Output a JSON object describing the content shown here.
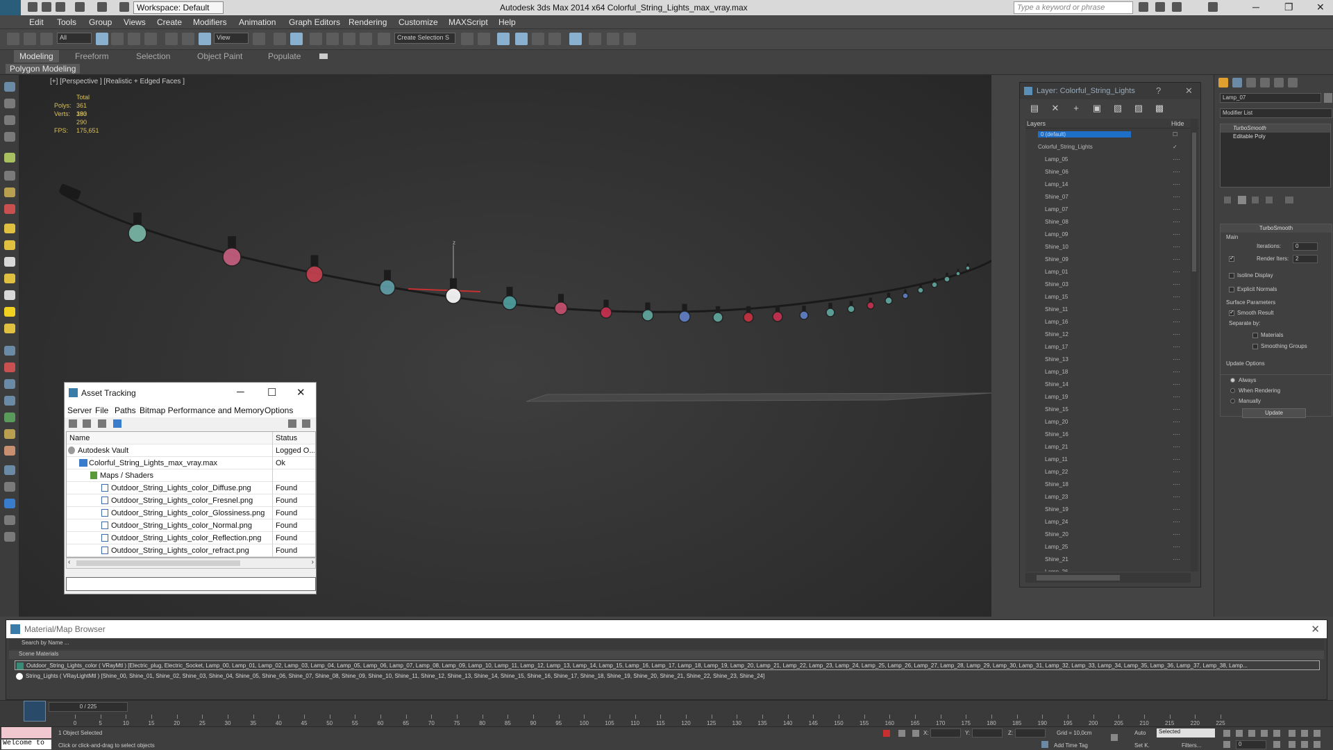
{
  "titlebar": {
    "workspace": "Workspace: Default",
    "title": "Autodesk 3ds Max  2014 x64      Colorful_String_Lights_max_vray.max",
    "search_placeholder": "Type a keyword or phrase"
  },
  "menu": [
    "Edit",
    "Tools",
    "Group",
    "Views",
    "Create",
    "Modifiers",
    "Animation",
    "Graph Editors",
    "Rendering",
    "Customize",
    "MAXScript",
    "Help"
  ],
  "toolbar": {
    "filter": "All",
    "refcoord": "View",
    "named_selection": "Create Selection S"
  },
  "ribbon": {
    "tabs": [
      "Modeling",
      "Freeform",
      "Selection",
      "Object Paint",
      "Populate"
    ],
    "panel_label": "Polygon Modeling"
  },
  "viewport": {
    "label": "[+] [Perspective ] [Realistic + Edged Faces ]",
    "stats_total": "Total",
    "polys_label": "Polys:",
    "polys_value": "361 390",
    "verts_label": "Verts:",
    "verts_value": "183 290",
    "fps_label": "FPS:",
    "fps_value": "175,651",
    "gizmo_label": "z"
  },
  "asset_tracking": {
    "title": "Asset Tracking",
    "menu": [
      "Server",
      "File",
      "Paths",
      "Bitmap Performance and Memory",
      "Options"
    ],
    "columns": [
      "Name",
      "Status"
    ],
    "rows": [
      {
        "name": "Autodesk Vault",
        "status": "Logged O..."
      },
      {
        "name": "Colorful_String_Lights_max_vray.max",
        "status": "Ok"
      },
      {
        "name": "Maps / Shaders",
        "status": ""
      },
      {
        "name": "Outdoor_String_Lights_color_Diffuse.png",
        "status": "Found"
      },
      {
        "name": "Outdoor_String_Lights_color_Fresnel.png",
        "status": "Found"
      },
      {
        "name": "Outdoor_String_Lights_color_Glossiness.png",
        "status": "Found"
      },
      {
        "name": "Outdoor_String_Lights_color_Normal.png",
        "status": "Found"
      },
      {
        "name": "Outdoor_String_Lights_color_Reflection.png",
        "status": "Found"
      },
      {
        "name": "Outdoor_String_Lights_color_refract.png",
        "status": "Found"
      }
    ]
  },
  "layer_explorer": {
    "title": "Layer: Colorful_String_Lights",
    "help": "?",
    "col_layers": "Layers",
    "col_hide": "Hide",
    "rows": [
      {
        "name": "0 (default)",
        "level": 1,
        "sel": true,
        "hide": "☐"
      },
      {
        "name": "Colorful_String_Lights",
        "level": 1,
        "hide": "✓"
      },
      {
        "name": "Lamp_05",
        "level": 2
      },
      {
        "name": "Shine_06",
        "level": 2
      },
      {
        "name": "Lamp_14",
        "level": 2
      },
      {
        "name": "Shine_07",
        "level": 2
      },
      {
        "name": "Lamp_07",
        "level": 2
      },
      {
        "name": "Shine_08",
        "level": 2
      },
      {
        "name": "Lamp_09",
        "level": 2
      },
      {
        "name": "Shine_10",
        "level": 2
      },
      {
        "name": "Shine_09",
        "level": 2
      },
      {
        "name": "Lamp_01",
        "level": 2
      },
      {
        "name": "Shine_03",
        "level": 2
      },
      {
        "name": "Lamp_15",
        "level": 2
      },
      {
        "name": "Shine_11",
        "level": 2
      },
      {
        "name": "Lamp_16",
        "level": 2
      },
      {
        "name": "Shine_12",
        "level": 2
      },
      {
        "name": "Lamp_17",
        "level": 2
      },
      {
        "name": "Shine_13",
        "level": 2
      },
      {
        "name": "Lamp_18",
        "level": 2
      },
      {
        "name": "Shine_14",
        "level": 2
      },
      {
        "name": "Lamp_19",
        "level": 2
      },
      {
        "name": "Shine_15",
        "level": 2
      },
      {
        "name": "Lamp_20",
        "level": 2
      },
      {
        "name": "Shine_16",
        "level": 2
      },
      {
        "name": "Lamp_21",
        "level": 2
      },
      {
        "name": "Lamp_11",
        "level": 2
      },
      {
        "name": "Lamp_22",
        "level": 2
      },
      {
        "name": "Shine_18",
        "level": 2
      },
      {
        "name": "Lamp_23",
        "level": 2
      },
      {
        "name": "Shine_19",
        "level": 2
      },
      {
        "name": "Lamp_24",
        "level": 2
      },
      {
        "name": "Shine_20",
        "level": 2
      },
      {
        "name": "Lamp_25",
        "level": 2
      },
      {
        "name": "Shine_21",
        "level": 2
      },
      {
        "name": "Lamp_26",
        "level": 2
      }
    ]
  },
  "command_panel": {
    "object_name": "Lamp_07",
    "modifier_list": "Modifier List",
    "stack": [
      "TurboSmooth",
      "Editable Poly"
    ],
    "turbosmooth": {
      "title": "TurboSmooth",
      "main": "Main",
      "iterations_label": "Iterations:",
      "iterations": "0",
      "render_iters_label": "Render Iters:",
      "render_iters": "2",
      "isoline": "Isoline Display",
      "explicit": "Explicit Normals",
      "surface_params": "Surface Parameters",
      "smooth_result": "Smooth Result",
      "separate_by": "Separate by:",
      "materials": "Materials",
      "smoothing_groups": "Smoothing Groups",
      "update_options": "Update Options",
      "always": "Always",
      "when_rendering": "When Rendering",
      "manually": "Manually",
      "update_btn": "Update"
    }
  },
  "material_browser": {
    "title": "Material/Map Browser",
    "search": "Search by Name ...",
    "section": "Scene Materials",
    "rows": [
      {
        "text": "Outdoor_String_Lights_color  ( VRayMtl )  [Electric_plug, Electric_Socket, Lamp_00, Lamp_01, Lamp_02, Lamp_03, Lamp_04, Lamp_05, Lamp_06, Lamp_07, Lamp_08, Lamp_09, Lamp_10, Lamp_11, Lamp_12, Lamp_13, Lamp_14, Lamp_15, Lamp_16, Lamp_17, Lamp_18, Lamp_19, Lamp_20, Lamp_21, Lamp_22, Lamp_23, Lamp_24, Lamp_25, Lamp_26, Lamp_27, Lamp_28, Lamp_29, Lamp_30, Lamp_31, Lamp_32, Lamp_33, Lamp_34, Lamp_35, Lamp_36, Lamp_37, Lamp_38, Lamp...",
        "swatch": "#3a8a78"
      },
      {
        "text": "String_Lights  ( VRayLightMtl )  [Shine_00, Shine_01, Shine_02, Shine_03, Shine_04, Shine_05, Shine_06, Shine_07, Shine_08, Shine_09, Shine_10, Shine_11, Shine_12, Shine_13, Shine_14, Shine_15, Shine_16, Shine_17, Shine_18, Shine_19, Shine_20, Shine_21, Shine_22, Shine_23, Shine_24]",
        "swatch": "#ffffff"
      }
    ]
  },
  "timeline": {
    "frame": "0 / 225",
    "ticks": [
      "0",
      "5",
      "10",
      "15",
      "20",
      "25",
      "30",
      "35",
      "40",
      "45",
      "50",
      "55",
      "60",
      "65",
      "70",
      "75",
      "80",
      "85",
      "90",
      "95",
      "100",
      "105",
      "110",
      "115",
      "120",
      "125",
      "130",
      "135",
      "140",
      "145",
      "150",
      "155",
      "160",
      "165",
      "170",
      "175",
      "180",
      "185",
      "190",
      "195",
      "200",
      "205",
      "210",
      "215",
      "220",
      "225"
    ]
  },
  "statusbar": {
    "maxscript": "Welcome to",
    "selected": "1 Object Selected",
    "prompt": "Click or click-and-drag to select objects",
    "x": "X:",
    "y": "Y:",
    "z": "Z:",
    "grid": "Grid = 10,0cm",
    "auto": "Auto",
    "set_key": "Set K.",
    "selected_dd": "Selected",
    "filters": "Filters...",
    "add_time_tag": "Add Time Tag",
    "frame": "0"
  },
  "colors": {
    "accent": "#1e6fc8",
    "bg": "#444444",
    "stat_yellow": "#d8c060"
  }
}
